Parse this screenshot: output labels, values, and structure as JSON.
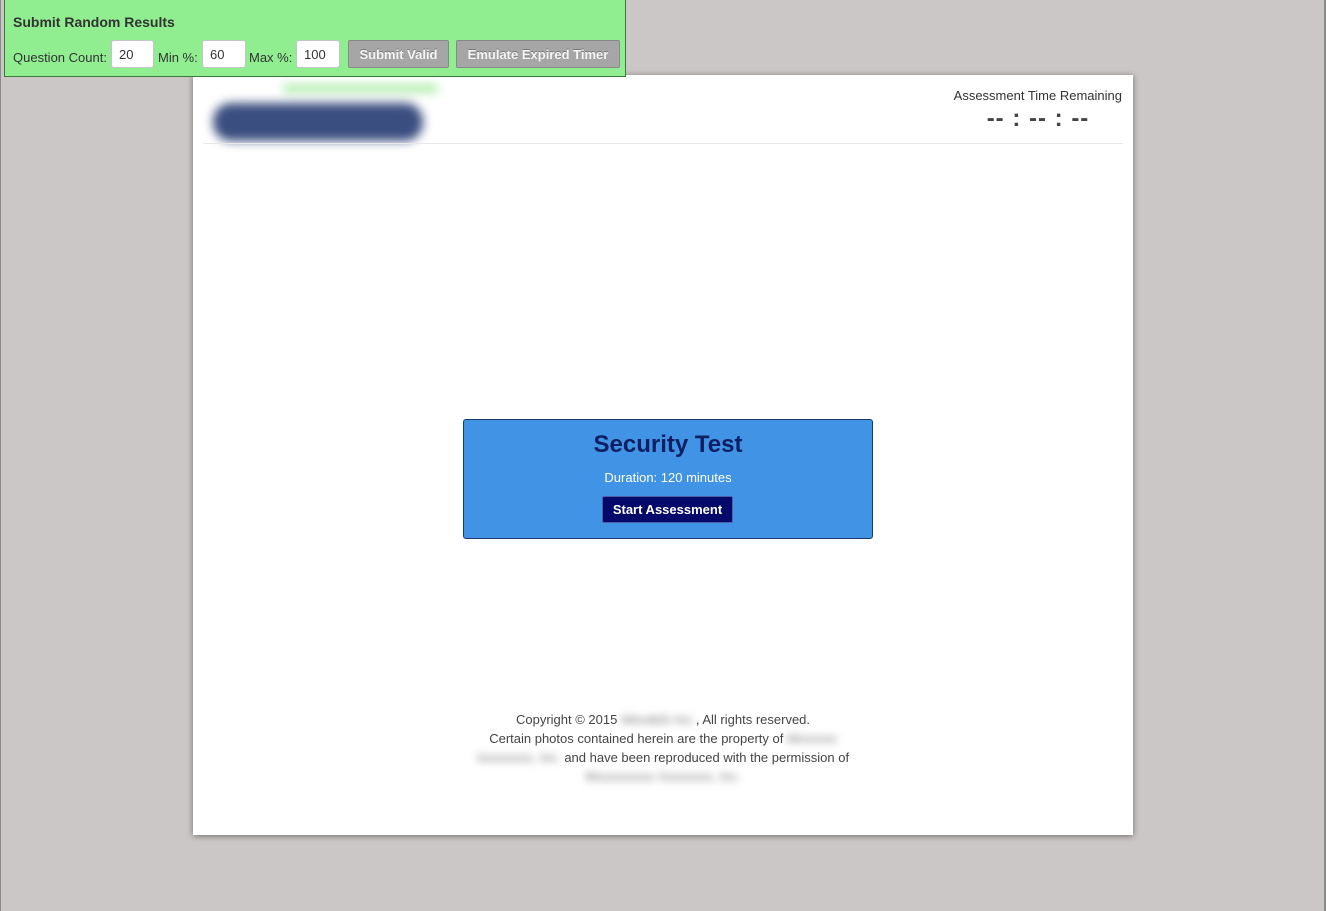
{
  "debug_panel": {
    "title": "Submit Random Results",
    "question_count_label": "Question Count:",
    "question_count_value": "20",
    "min_label": "Min %:",
    "min_value": "60",
    "max_label": "Max %:",
    "max_value": "100",
    "submit_label": "Submit Valid",
    "expire_label": "Emulate Expired Timer"
  },
  "header": {
    "timer_label": "Assessment Time Remaining",
    "timer_value": "-- : -- : --"
  },
  "assessment": {
    "title": "Security Test",
    "duration": "Duration: 120 minutes",
    "start_label": "Start Assessment"
  },
  "footer": {
    "line1_pre": "Copyright © 2015 ",
    "line1_blur": "Wexdefx Inc.",
    "line1_post": ", All rights reserved.",
    "line2_pre": "Certain photos contained herein are the property of ",
    "line2_blur": "Mxxxxxx",
    "line3_blur": "Ixxxxxxxx, Inc.",
    "line3_post": " and have been reproduced with the permission of",
    "line4_blur": "Mxxxxxxxxx Xxxxxxxx, Inc."
  },
  "colors": {
    "debug_bg": "#90ee90",
    "assessment_bg": "#4193e6",
    "start_button_bg": "#050a6a",
    "page_bg": "#cbc7c6"
  }
}
